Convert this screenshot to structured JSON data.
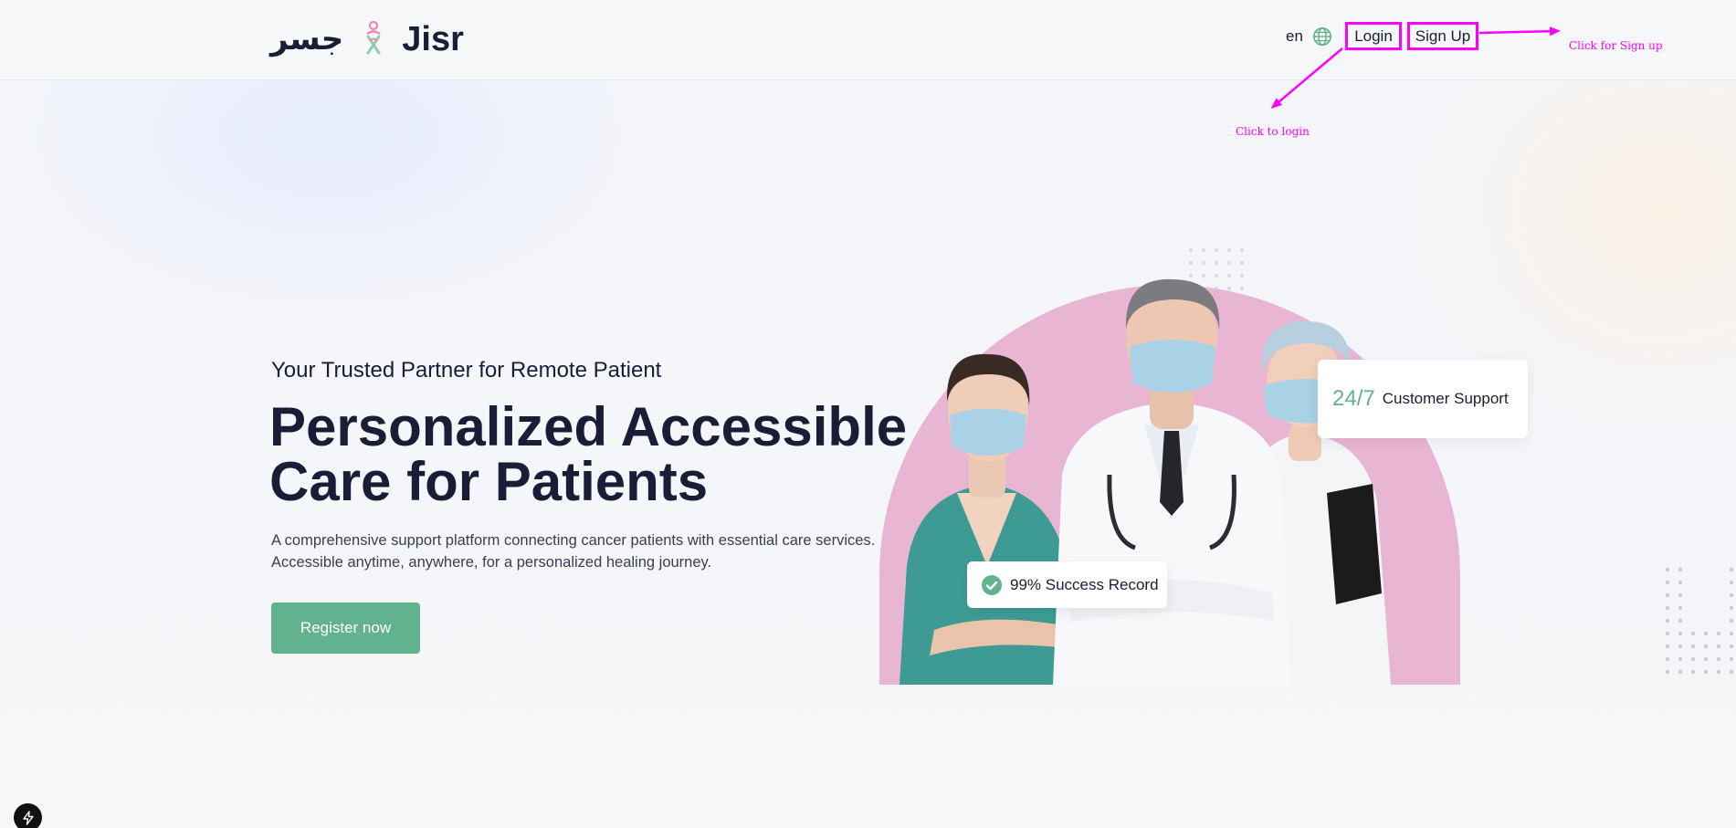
{
  "header": {
    "logo_arabic": "جسر",
    "logo_text": "Jisr",
    "language": "en",
    "login_label": "Login",
    "signup_label": "Sign Up"
  },
  "annotations": {
    "login": "Click to login",
    "signup": "Click for Sign up",
    "color": "#ff00ff"
  },
  "hero": {
    "subtitle": "Your Trusted Partner for Remote Patient",
    "title_lines": [
      "Personalized Accessible",
      "Care for Patients"
    ],
    "description_lines": [
      "A comprehensive support platform connecting cancer patients with essential care services.",
      "Accessible anytime, anywhere, for a personalized healing journey."
    ],
    "cta_label": "Register now"
  },
  "cards": {
    "support_value": "24/7",
    "support_label": "Customer Support",
    "success_label": "99% Success Record"
  },
  "colors": {
    "accent": "#62b28e",
    "text": "#1b1d36",
    "arch": "#e8b6d3"
  },
  "icons": {
    "globe": "globe-icon",
    "check": "check-circle-icon",
    "dev_badge": "lightning-icon"
  }
}
